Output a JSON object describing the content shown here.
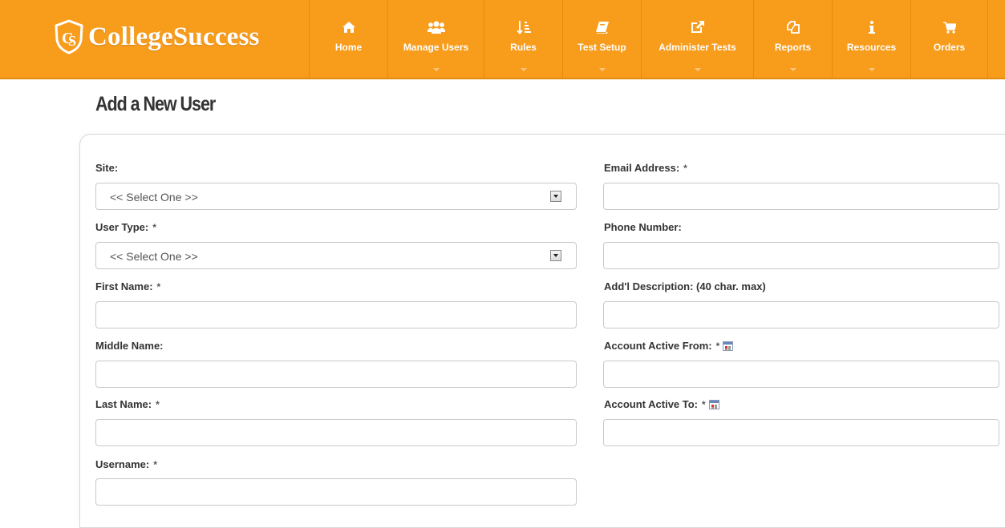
{
  "brand": {
    "name": "CollegeSuccess"
  },
  "nav": [
    {
      "label": "Home",
      "icon": "home-icon"
    },
    {
      "label": "Manage Users",
      "icon": "users-icon"
    },
    {
      "label": "Rules",
      "icon": "sort-icon"
    },
    {
      "label": "Test Setup",
      "icon": "book-icon"
    },
    {
      "label": "Administer Tests",
      "icon": "external-link-icon"
    },
    {
      "label": "Reports",
      "icon": "copy-icon"
    },
    {
      "label": "Resources",
      "icon": "info-icon"
    },
    {
      "label": "Orders",
      "icon": "cart-icon"
    }
  ],
  "page": {
    "title": "Add a New User"
  },
  "form": {
    "required_mark": "*",
    "site": {
      "label": "Site:",
      "value": "<< Select One >>"
    },
    "user_type": {
      "label": "User Type:",
      "value": "<< Select One >>"
    },
    "first_name": {
      "label": "First Name:"
    },
    "middle_name": {
      "label": "Middle Name:"
    },
    "last_name": {
      "label": "Last Name:"
    },
    "username": {
      "label": "Username:"
    },
    "email": {
      "label": "Email Address:"
    },
    "phone": {
      "label": "Phone Number:"
    },
    "description": {
      "label": "Add'l Description: (40 char. max)"
    },
    "active_from": {
      "label": "Account Active From:"
    },
    "active_to": {
      "label": "Account Active To:"
    }
  },
  "colors": {
    "header": "#f89c1c",
    "text": "#333333"
  }
}
